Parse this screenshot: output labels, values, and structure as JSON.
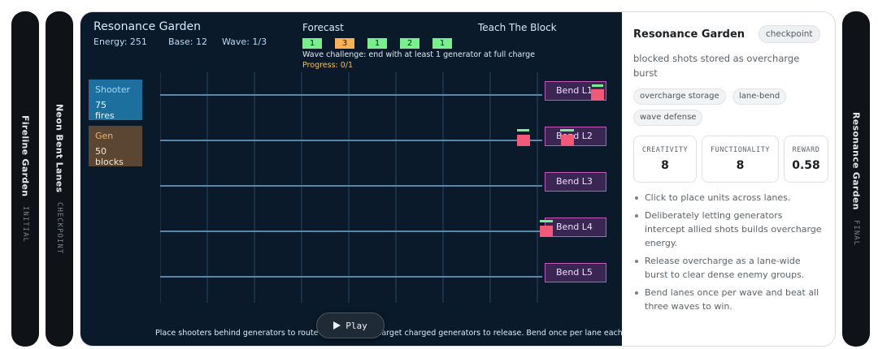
{
  "strips": {
    "left1": {
      "title": "Fireline Garden",
      "stage": "INITIAL"
    },
    "left2": {
      "title": "Neon Bent Lanes",
      "stage": "CHECKPOINT"
    },
    "right": {
      "title": "Resonance Garden",
      "stage": "FINAL"
    }
  },
  "game": {
    "title": "Resonance Garden",
    "stats": {
      "energy": "Energy: 251",
      "base": "Base: 12",
      "wave": "Wave: 1/3"
    },
    "forecast_label": "Forecast",
    "teach_label": "Teach The Block",
    "forecast": [
      {
        "value": "1",
        "color": "#78f08e"
      },
      {
        "value": "3",
        "color": "#f6b254"
      },
      {
        "value": "1",
        "color": "#78f08e"
      },
      {
        "value": "2",
        "color": "#78f08e"
      },
      {
        "value": "1",
        "color": "#78f08e"
      }
    ],
    "challenge": "Wave challenge: end with at least 1 generator at full charge",
    "progress": "Progress: 0/1",
    "units": {
      "shooter": {
        "name": "Shooter",
        "count": "75",
        "unit": "fires",
        "color": "#1d6f9e"
      },
      "gen": {
        "name": "Gen",
        "count": "50",
        "unit": "blocks",
        "color": "#5a4632"
      }
    },
    "bends": [
      "Bend L1",
      "Bend L2",
      "Bend L3",
      "Bend L4",
      "Bend L5"
    ],
    "play_label": "Play",
    "hint": "Place shooters behind generators to route fire into them. Target charged generators to release. Bend once per lane each wave.",
    "colors": {
      "enemy": "#f05a78",
      "charge": "#78f08e",
      "bend_border": "#c458b8"
    }
  },
  "side": {
    "title": "Resonance Garden",
    "badge": "checkpoint",
    "description": "blocked shots stored as overcharge burst",
    "tags": [
      "overcharge storage",
      "lane-bend",
      "wave defense"
    ],
    "metrics": [
      {
        "label": "CREATIVITY",
        "value": "8"
      },
      {
        "label": "FUNCTIONALITY",
        "value": "8"
      },
      {
        "label": "REWARD",
        "value": "0.58"
      }
    ],
    "bullets": [
      "Click to place units across lanes.",
      "Deliberately letting generators intercept allied shots builds overcharge energy.",
      "Release overcharge as a lane-wide burst to clear dense enemy groups.",
      "Bend lanes once per wave and beat all three waves to win."
    ]
  }
}
